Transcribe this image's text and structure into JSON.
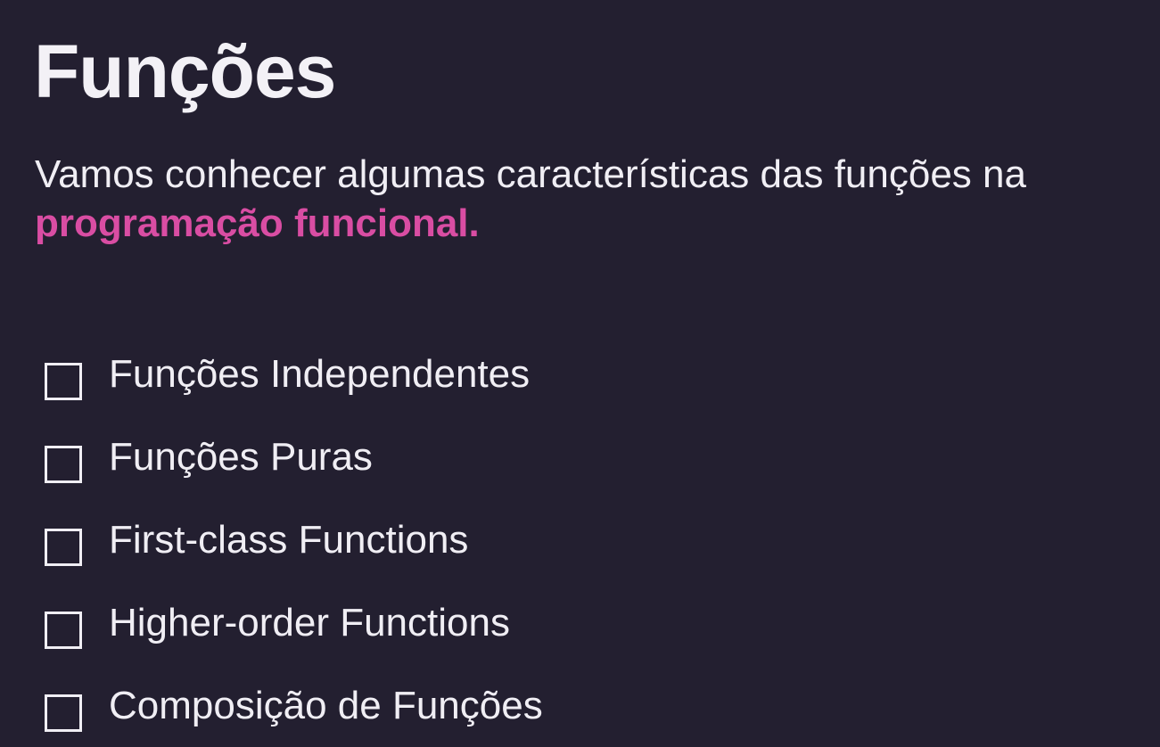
{
  "slide": {
    "title": "Funções",
    "subtitle": {
      "text": "Vamos conhecer algumas características das funções na",
      "highlight": "programação funcional.",
      "highlight_color": "#d94da3"
    },
    "checklist": [
      {
        "label": "Funções Independentes",
        "checked": false
      },
      {
        "label": "Funções Puras",
        "checked": false
      },
      {
        "label": "First-class Functions",
        "checked": false
      },
      {
        "label": "Higher-order Functions",
        "checked": false
      },
      {
        "label": "Composição de Funções",
        "checked": false
      }
    ]
  },
  "theme": {
    "background": "#231f30",
    "text": "#f0eef4"
  }
}
